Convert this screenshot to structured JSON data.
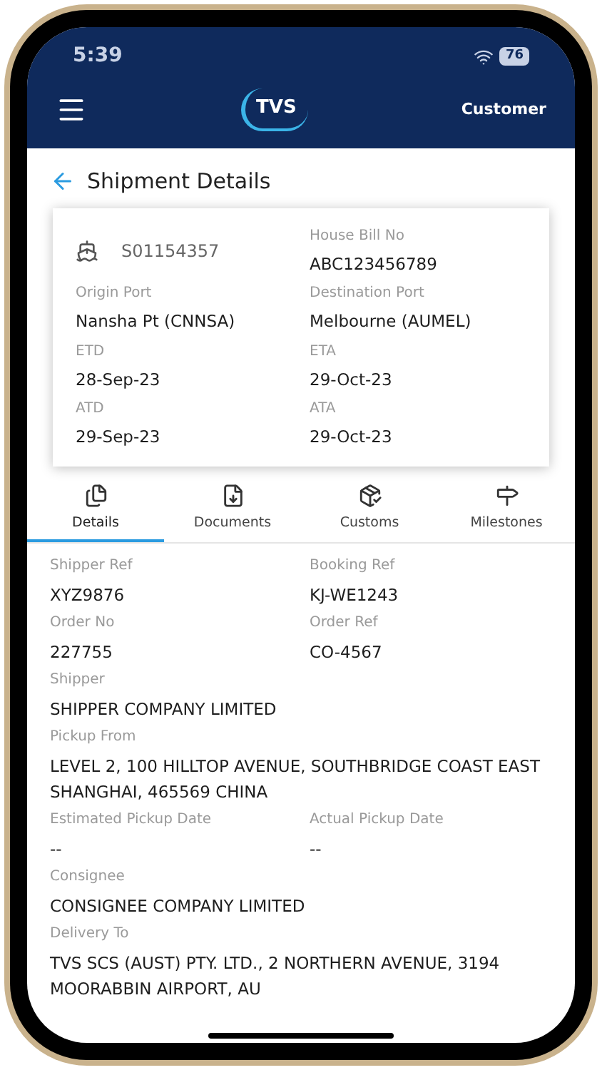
{
  "status_bar": {
    "time": "5:39",
    "battery": "76"
  },
  "header": {
    "logo": "TVS",
    "account": "Customer"
  },
  "page_title": "Shipment Details",
  "summary": {
    "shipment_no": "S01154357",
    "fields": [
      {
        "label": "House Bill No",
        "value": "ABC123456789"
      },
      {
        "label": "Origin Port",
        "value": "Nansha Pt (CNNSA)"
      },
      {
        "label": "Destination Port",
        "value": "Melbourne (AUMEL)"
      },
      {
        "label": "ETD",
        "value": "28-Sep-23"
      },
      {
        "label": "ETA",
        "value": "29-Oct-23"
      },
      {
        "label": "ATD",
        "value": "29-Sep-23"
      },
      {
        "label": "ATA",
        "value": "29-Oct-23"
      }
    ]
  },
  "tabs": [
    {
      "label": "Details",
      "kind": "details",
      "selected": true
    },
    {
      "label": "Documents",
      "kind": "documents",
      "selected": false
    },
    {
      "label": "Customs",
      "kind": "customs",
      "selected": false
    },
    {
      "label": "Milestones",
      "kind": "milestones",
      "selected": false
    }
  ],
  "details": [
    {
      "label": "Shipper Ref",
      "value": "XYZ9876",
      "kind": "half"
    },
    {
      "label": "Booking Ref",
      "value": "KJ-WE1243",
      "kind": "half"
    },
    {
      "label": "Order No",
      "value": "227755",
      "kind": "half"
    },
    {
      "label": "Order Ref",
      "value": "CO-4567",
      "kind": "half"
    },
    {
      "label": "Shipper",
      "value": "SHIPPER COMPANY LIMITED",
      "kind": "full"
    },
    {
      "label": "Pickup From",
      "value": "LEVEL 2, 100 HILLTOP AVENUE, SOUTHBRIDGE COAST EAST SHANGHAI, 465569 CHINA",
      "kind": "full"
    },
    {
      "label": "Estimated Pickup Date",
      "value": "--",
      "kind": "half"
    },
    {
      "label": "Actual Pickup Date",
      "value": "--",
      "kind": "half"
    },
    {
      "label": "Consignee",
      "value": "CONSIGNEE COMPANY LIMITED",
      "kind": "full"
    },
    {
      "label": "Delivery To",
      "value": "TVS SCS (AUST) PTY. LTD., 2 NORTHERN AVENUE, 3194 MOORABBIN AIRPORT, AU",
      "kind": "full"
    }
  ]
}
